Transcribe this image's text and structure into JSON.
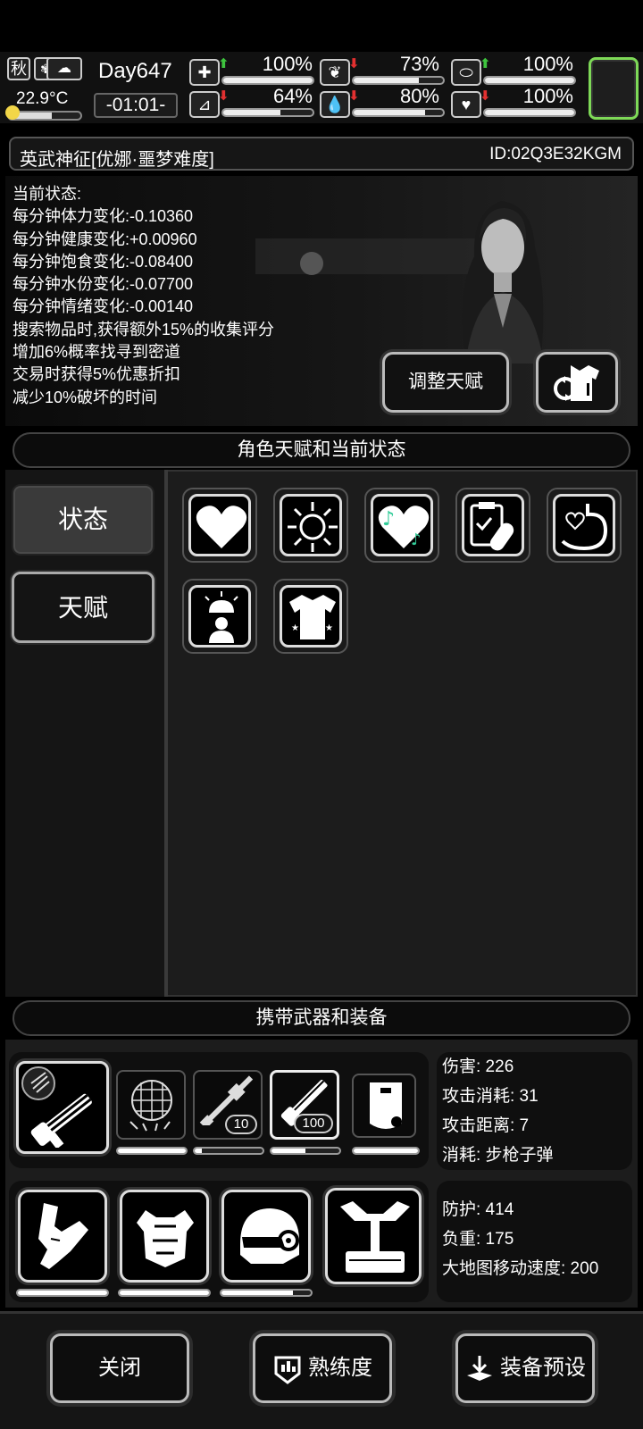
{
  "topbar": {
    "season_label": "秋",
    "temperature": "22.9°C",
    "temperature_level": 0.6,
    "day": "Day647",
    "clock": "-01:01-",
    "stats": [
      {
        "icon": "medkit-icon",
        "trend": "up",
        "value": "100%",
        "level": 1.0
      },
      {
        "icon": "stomach-icon",
        "trend": "down",
        "value": "73%",
        "level": 0.73
      },
      {
        "icon": "pill-icon",
        "trend": "up",
        "value": "100%",
        "level": 1.0
      },
      {
        "icon": "boot-icon",
        "trend": "down",
        "value": "64%",
        "level": 0.64
      },
      {
        "icon": "water-drop-icon",
        "trend": "down",
        "value": "80%",
        "level": 0.8
      },
      {
        "icon": "heart-icon",
        "trend": "down",
        "value": "100%",
        "level": 1.0
      }
    ],
    "accent_color": "#7ed957"
  },
  "character": {
    "name": "英武神征[优娜·噩梦难度]",
    "id": "ID:02Q3E32KGM",
    "status_lines": [
      "当前状态:",
      "每分钟体力变化:-0.10360",
      "每分钟健康变化:+0.00960",
      "每分钟饱食变化:-0.08400",
      "每分钟水份变化:-0.07700",
      "每分钟情绪变化:-0.00140",
      "搜索物品时,获得额外15%的收集评分",
      "增加6%概率找寻到密道",
      "交易时获得5%优惠折扣",
      "减少10%破坏的时间"
    ],
    "adjust_talent_label": "调整天赋"
  },
  "talent_section": {
    "header": "角色天赋和当前状态",
    "tabs": [
      "状态",
      "天赋"
    ],
    "selected_tab": "状态",
    "icons": [
      "heart-icon",
      "sun-icon",
      "music-heart-icon",
      "clipboard-pill-icon",
      "stomach-heart-icon",
      "alarm-person-icon",
      "shirt-icon"
    ]
  },
  "equipment_section": {
    "header": "携带武器和装备",
    "weapon_slots": [
      {
        "icon": "minigun-icon",
        "level": null
      },
      {
        "icon": "net-icon",
        "level": 1.0
      },
      {
        "icon": "rifle-icon",
        "count": "10",
        "level": 0.1
      },
      {
        "icon": "minigun-icon",
        "count": "100",
        "level": 0.5
      },
      {
        "icon": "riot-shield-icon",
        "level": 1.0
      }
    ],
    "weapon_stats": {
      "damage": "伤害: 226",
      "attack_cost": "攻击消耗: 31",
      "attack_range": "攻击距离: 7",
      "consume": "消耗: 步枪子弹"
    },
    "armor_slots": [
      {
        "icon": "arm-armor-icon",
        "level": 1.0
      },
      {
        "icon": "body-armor-icon",
        "level": 1.0
      },
      {
        "icon": "helmet-icon",
        "level": 0.8
      },
      {
        "icon": "exoskeleton-icon",
        "level": null
      }
    ],
    "armor_stats": {
      "defense": "防护: 414",
      "weight": "负重: 175",
      "map_speed": "大地图移动速度: 200"
    }
  },
  "bottom_buttons": {
    "close": "关闭",
    "proficiency": "熟练度",
    "preset": "装备预设"
  }
}
